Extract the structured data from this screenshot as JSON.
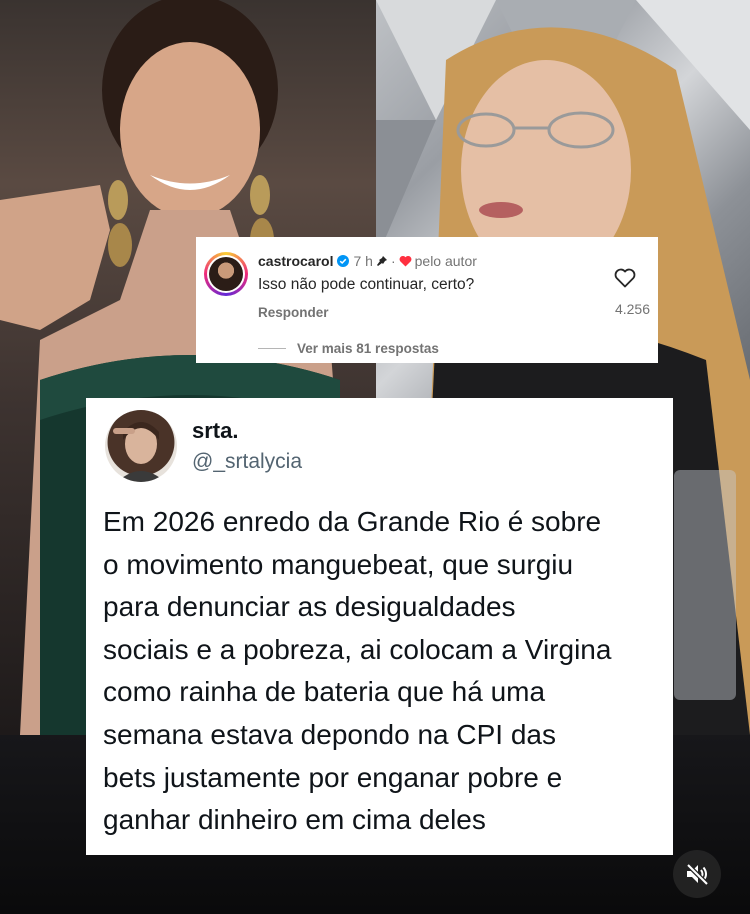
{
  "comment": {
    "username": "castrocarol",
    "time": "7 h",
    "separator": "·",
    "liked_by_author": "pelo autor",
    "text": "Isso não pode continuar, certo?",
    "reply_label": "Responder",
    "like_count": "4.256",
    "view_more": "Ver mais 81 respostas",
    "icons": [
      "verified-badge-icon",
      "pin-icon",
      "heart-filled-icon",
      "heart-outline-icon"
    ],
    "colors": {
      "verified": "#0095f6",
      "author_heart": "#ff3040"
    }
  },
  "tweet": {
    "name": "srta.",
    "handle": "@_srtalycia",
    "lines": [
      "Em 2026 enredo da Grande Rio é sobre",
      "o movimento manguebeat, que surgiu",
      "para denunciar as desigualdades",
      "sociais e a pobreza, ai colocam a Virgina",
      "como rainha de bateria que há uma",
      "semana estava depondo na CPI das",
      "bets justamente por enganar pobre e",
      "ganhar dinheiro em cima deles"
    ]
  },
  "controls": {
    "mute_icon": "speaker-muted-icon"
  }
}
